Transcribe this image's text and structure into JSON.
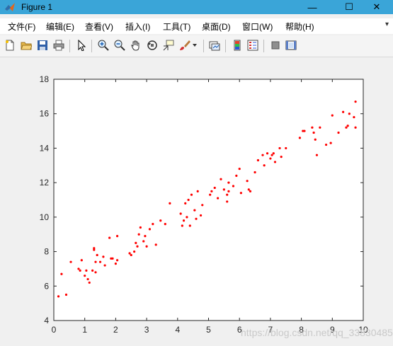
{
  "window": {
    "title": "Figure 1",
    "minimize_glyph": "—",
    "maximize_glyph": "☐",
    "close_glyph": "✕"
  },
  "menu": [
    {
      "label": "文件(F)"
    },
    {
      "label": "编辑(E)"
    },
    {
      "label": "查看(V)"
    },
    {
      "label": "插入(I)"
    },
    {
      "label": "工具(T)"
    },
    {
      "label": "桌面(D)"
    },
    {
      "label": "窗口(W)"
    },
    {
      "label": "帮助(H)"
    }
  ],
  "toolbar": [
    {
      "icon": "new-figure-icon"
    },
    {
      "icon": "open-file-icon"
    },
    {
      "icon": "save-icon"
    },
    {
      "icon": "print-icon"
    },
    {
      "icon": "edit-plot-icon"
    },
    {
      "icon": "zoom-in-icon"
    },
    {
      "icon": "zoom-out-icon"
    },
    {
      "icon": "pan-icon"
    },
    {
      "icon": "rotate-3d-icon"
    },
    {
      "icon": "data-cursor-icon"
    },
    {
      "icon": "brush-icon"
    },
    {
      "icon": "link-plot-icon"
    },
    {
      "icon": "insert-colorbar-icon"
    },
    {
      "icon": "insert-legend-icon"
    },
    {
      "icon": "hide-plot-tools-icon"
    },
    {
      "icon": "show-plot-tools-icon"
    }
  ],
  "watermark": "https://blog.csdn.net/qq_33830485",
  "chart_data": {
    "type": "scatter",
    "marker_color": "#ff0000",
    "xlim": [
      0,
      10
    ],
    "ylim": [
      4,
      18
    ],
    "xticks": [
      0,
      1,
      2,
      3,
      4,
      5,
      6,
      7,
      8,
      9,
      10
    ],
    "yticks": [
      4,
      6,
      8,
      10,
      12,
      14,
      16,
      18
    ],
    "grid": false,
    "points": [
      [
        0.15,
        5.4
      ],
      [
        0.25,
        6.7
      ],
      [
        0.4,
        5.5
      ],
      [
        0.55,
        7.4
      ],
      [
        0.8,
        7.0
      ],
      [
        0.85,
        6.9
      ],
      [
        0.9,
        7.5
      ],
      [
        1.0,
        6.6
      ],
      [
        1.05,
        6.9
      ],
      [
        1.1,
        6.4
      ],
      [
        1.15,
        6.2
      ],
      [
        1.25,
        6.9
      ],
      [
        1.3,
        8.2
      ],
      [
        1.3,
        8.1
      ],
      [
        1.35,
        7.4
      ],
      [
        1.35,
        6.8
      ],
      [
        1.4,
        7.8
      ],
      [
        1.5,
        7.4
      ],
      [
        1.6,
        7.7
      ],
      [
        1.65,
        7.2
      ],
      [
        1.8,
        8.8
      ],
      [
        1.85,
        7.6
      ],
      [
        1.9,
        7.6
      ],
      [
        2.0,
        7.3
      ],
      [
        2.05,
        8.9
      ],
      [
        2.05,
        7.5
      ],
      [
        2.45,
        7.9
      ],
      [
        2.5,
        7.8
      ],
      [
        2.6,
        8.0
      ],
      [
        2.65,
        8.5
      ],
      [
        2.7,
        8.3
      ],
      [
        2.75,
        9.0
      ],
      [
        2.8,
        9.4
      ],
      [
        2.9,
        8.6
      ],
      [
        2.95,
        8.9
      ],
      [
        3.0,
        8.3
      ],
      [
        3.1,
        9.3
      ],
      [
        3.2,
        9.6
      ],
      [
        3.3,
        8.4
      ],
      [
        3.45,
        9.8
      ],
      [
        3.6,
        9.6
      ],
      [
        3.75,
        10.8
      ],
      [
        4.1,
        10.2
      ],
      [
        4.15,
        9.5
      ],
      [
        4.2,
        9.8
      ],
      [
        4.25,
        10.8
      ],
      [
        4.3,
        10.0
      ],
      [
        4.35,
        11.0
      ],
      [
        4.4,
        9.5
      ],
      [
        4.45,
        11.3
      ],
      [
        4.55,
        10.4
      ],
      [
        4.6,
        9.9
      ],
      [
        4.65,
        11.5
      ],
      [
        4.75,
        10.1
      ],
      [
        4.8,
        10.7
      ],
      [
        5.05,
        11.3
      ],
      [
        5.1,
        11.5
      ],
      [
        5.2,
        11.7
      ],
      [
        5.3,
        11.1
      ],
      [
        5.4,
        12.2
      ],
      [
        5.5,
        11.6
      ],
      [
        5.6,
        11.3
      ],
      [
        5.6,
        10.9
      ],
      [
        5.65,
        12.0
      ],
      [
        5.65,
        11.5
      ],
      [
        5.8,
        11.8
      ],
      [
        5.9,
        12.4
      ],
      [
        6.0,
        12.8
      ],
      [
        6.05,
        11.4
      ],
      [
        6.25,
        12.1
      ],
      [
        6.3,
        11.6
      ],
      [
        6.35,
        11.5
      ],
      [
        6.5,
        12.6
      ],
      [
        6.6,
        13.3
      ],
      [
        6.75,
        13.6
      ],
      [
        6.8,
        13.0
      ],
      [
        6.9,
        13.7
      ],
      [
        7.0,
        13.4
      ],
      [
        7.05,
        13.6
      ],
      [
        7.1,
        13.7
      ],
      [
        7.15,
        13.2
      ],
      [
        7.3,
        14.0
      ],
      [
        7.35,
        13.5
      ],
      [
        7.5,
        14.0
      ],
      [
        7.95,
        14.6
      ],
      [
        8.05,
        15.0
      ],
      [
        8.1,
        15.0
      ],
      [
        8.35,
        15.2
      ],
      [
        8.4,
        14.9
      ],
      [
        8.45,
        14.5
      ],
      [
        8.5,
        13.6
      ],
      [
        8.6,
        15.2
      ],
      [
        8.8,
        14.2
      ],
      [
        8.95,
        14.3
      ],
      [
        9.0,
        15.9
      ],
      [
        9.2,
        14.9
      ],
      [
        9.35,
        16.1
      ],
      [
        9.45,
        15.2
      ],
      [
        9.5,
        15.3
      ],
      [
        9.55,
        16.0
      ],
      [
        9.7,
        15.8
      ],
      [
        9.75,
        15.2
      ],
      [
        9.75,
        16.7
      ]
    ]
  }
}
